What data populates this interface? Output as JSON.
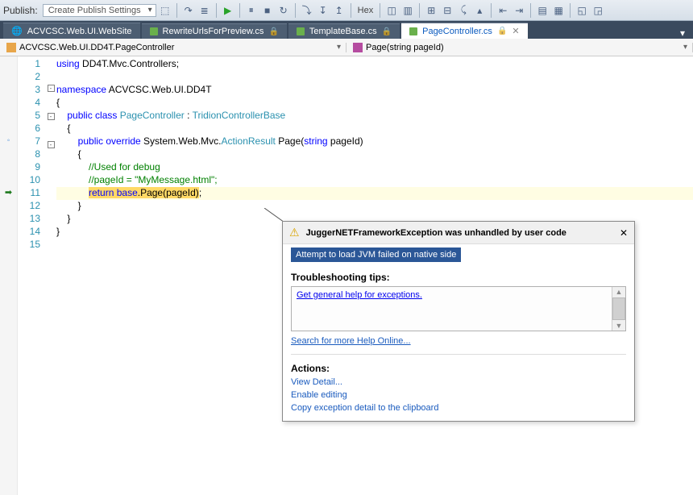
{
  "toolbar": {
    "publish_label": "Publish:",
    "publish_dropdown": "Create Publish Settings",
    "hex_label": "Hex"
  },
  "tabs": [
    {
      "label": "ACVCSC.Web.UI.WebSite",
      "active": false,
      "type": "project"
    },
    {
      "label": "RewriteUrlsForPreview.cs",
      "active": false,
      "type": "cs",
      "locked": true
    },
    {
      "label": "TemplateBase.cs",
      "active": false,
      "type": "cs",
      "locked": true
    },
    {
      "label": "PageController.cs",
      "active": true,
      "type": "cs",
      "locked": true
    }
  ],
  "crumbs": {
    "class": "ACVCSC.Web.UI.DD4T.PageController",
    "member": "Page(string pageId)"
  },
  "code_lines": [
    {
      "n": 1,
      "fold": "",
      "text": "using DD4T.Mvc.Controllers;",
      "tokens": [
        {
          "t": "using ",
          "c": "kw"
        },
        {
          "t": "DD4T.Mvc.Controllers;"
        }
      ]
    },
    {
      "n": 2,
      "fold": "",
      "text": ""
    },
    {
      "n": 3,
      "fold": "-",
      "text": "namespace ACVCSC.Web.UI.DD4T",
      "tokens": [
        {
          "t": "namespace ",
          "c": "kw"
        },
        {
          "t": "ACVCSC.Web.UI.DD4T"
        }
      ]
    },
    {
      "n": 4,
      "fold": "",
      "text": "{"
    },
    {
      "n": 5,
      "fold": "-",
      "text": "    public class PageController : TridionControllerBase",
      "tokens": [
        {
          "t": "    "
        },
        {
          "t": "public class ",
          "c": "kw"
        },
        {
          "t": "PageController",
          "c": "type"
        },
        {
          "t": " : "
        },
        {
          "t": "TridionControllerBase",
          "c": "type"
        }
      ]
    },
    {
      "n": 6,
      "fold": "",
      "text": "    {"
    },
    {
      "n": 7,
      "fold": "-",
      "text": "        public override System.Web.Mvc.ActionResult Page(string pageId)",
      "tokens": [
        {
          "t": "        "
        },
        {
          "t": "public override ",
          "c": "kw"
        },
        {
          "t": "System.Web.Mvc."
        },
        {
          "t": "ActionResult",
          "c": "type"
        },
        {
          "t": " Page("
        },
        {
          "t": "string",
          "c": "kw"
        },
        {
          "t": " pageId)"
        }
      ],
      "glyph": "gutter"
    },
    {
      "n": 8,
      "fold": "",
      "text": "        {"
    },
    {
      "n": 9,
      "fold": "",
      "text": "            //Used for debug",
      "tokens": [
        {
          "t": "            "
        },
        {
          "t": "//Used for debug",
          "c": "cmt"
        }
      ]
    },
    {
      "n": 10,
      "fold": "",
      "text": "            //pageId = \"MyMessage.html\";",
      "tokens": [
        {
          "t": "            "
        },
        {
          "t": "//pageId = \"MyMessage.html\";",
          "c": "cmt"
        }
      ]
    },
    {
      "n": 11,
      "fold": "",
      "hl": true,
      "glyph": "arrow",
      "text": "            return base.Page(pageId);",
      "tokens": [
        {
          "t": "            "
        },
        {
          "t": "return",
          "c": "kw",
          "sel": true
        },
        {
          "t": " ",
          "sel": true
        },
        {
          "t": "base",
          "c": "kw",
          "sel": true
        },
        {
          "t": ".Page(pageId)",
          "sel": true
        },
        {
          "t": ";"
        }
      ]
    },
    {
      "n": 12,
      "fold": "",
      "text": "        }"
    },
    {
      "n": 13,
      "fold": "",
      "text": "    }"
    },
    {
      "n": 14,
      "fold": "",
      "text": "}"
    },
    {
      "n": 15,
      "fold": "",
      "text": ""
    }
  ],
  "exception": {
    "title": "JuggerNETFrameworkException was unhandled by user code",
    "message": "Attempt to load JVM failed on native side",
    "troubleshooting_label": "Troubleshooting tips:",
    "tip_general": "Get general help for exceptions.",
    "search_online": "Search for more Help Online...",
    "actions_label": "Actions:",
    "action_detail": "View Detail...",
    "action_enable": "Enable editing",
    "action_copy": "Copy exception detail to the clipboard"
  }
}
